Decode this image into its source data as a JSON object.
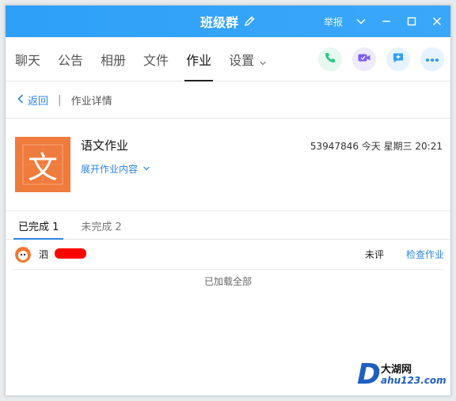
{
  "window": {
    "title": "班级群",
    "report": "举报",
    "accent": "#2ea0f8"
  },
  "tabs": [
    {
      "label": "聊天"
    },
    {
      "label": "公告"
    },
    {
      "label": "相册"
    },
    {
      "label": "文件"
    },
    {
      "label": "作业",
      "active": true
    },
    {
      "label": "设置"
    }
  ],
  "actions": [
    {
      "name": "phone-call",
      "icon": "phone-icon",
      "color": "#2cc889"
    },
    {
      "name": "video-call",
      "icon": "video-icon",
      "color": "#7b5cf0"
    },
    {
      "name": "add-content",
      "icon": "plus-square-icon",
      "color": "#2d9cf5"
    },
    {
      "name": "more",
      "icon": "more-icon",
      "color": "#2d9cf5"
    }
  ],
  "breadcrumb": {
    "back": "返回",
    "separator": "|",
    "current": "作业详情"
  },
  "homework": {
    "icon_char": "文",
    "title": "语文作业",
    "expand": "展开作业内容",
    "meta": "53947846 今天 星期三 20:21"
  },
  "status_tabs": {
    "completed": "已完成 1",
    "incomplete": "未完成 2"
  },
  "submissions": [
    {
      "name": "泗",
      "grade": "未评",
      "action": "检查作业"
    }
  ],
  "footer": {
    "loaded": "已加载全部"
  },
  "watermark": {
    "letter": "D",
    "top": "大湖网",
    "bottom": "ahu123.com"
  }
}
